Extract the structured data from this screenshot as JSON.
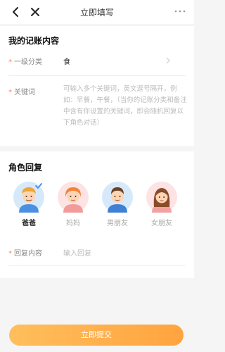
{
  "nav": {
    "title": "立即填写",
    "back_icon": "chevron-left-icon",
    "close_icon": "close-icon",
    "more_icon": "more-dots-icon"
  },
  "record": {
    "section_title": "我的记账内容",
    "category": {
      "required_mark": "*",
      "label": "一级分类",
      "value": "食"
    },
    "keyword": {
      "required_mark": "*",
      "label": "关键词",
      "placeholder": "可输入多个关键词，英文逗号隔开，例如：早餐，午餐，（当你的记账分类和备注中含有你设置的关键词，即会随机回复以下角色对话）"
    }
  },
  "role": {
    "section_title": "角色回复",
    "avatars": [
      {
        "name": "爸爸",
        "selected": true
      },
      {
        "name": "妈妈",
        "selected": false
      },
      {
        "name": "男朋友",
        "selected": false
      },
      {
        "name": "女朋友",
        "selected": false
      }
    ],
    "reply": {
      "required_mark": "*",
      "label": "回复内容",
      "placeholder": "输入回复"
    }
  },
  "submit_label": "立即提交",
  "colors": {
    "accent": "#ffa43f",
    "required": "#f08a5d"
  }
}
